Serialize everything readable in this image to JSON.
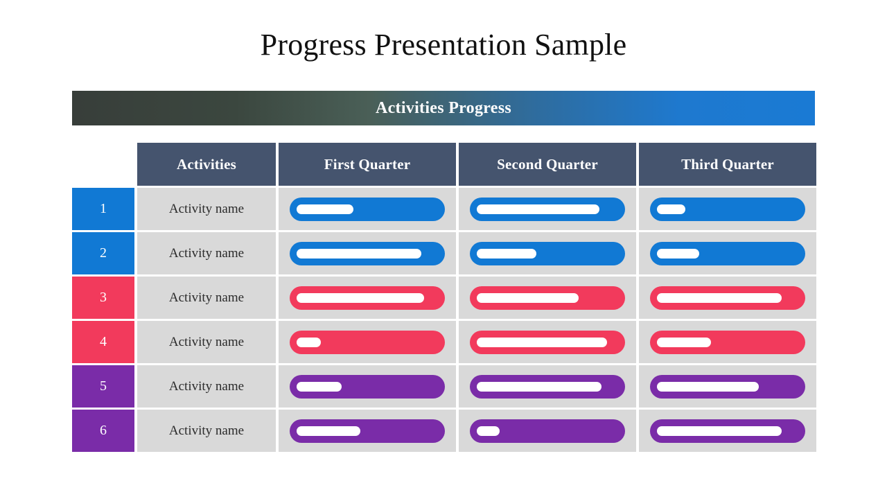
{
  "slide": {
    "title": "Progress Presentation Sample",
    "banner_label": "Activities Progress"
  },
  "colors": {
    "blue": "#1179d4",
    "red": "#f23a5c",
    "purple": "#7a2ca8",
    "header_bg": "#45546e",
    "cell_bg": "#d9d9d9",
    "banner_gradient_start": "#383e3a",
    "banner_gradient_end": "#1a7ad4",
    "bar_inner": "#ffffff"
  },
  "table": {
    "headers": [
      "Activities",
      "First Quarter",
      "Second Quarter",
      "Third Quarter"
    ],
    "rows": [
      {
        "number": "1",
        "activity": "Activity name",
        "color": "#1179d4",
        "quarters": [
          {
            "quarter": "First Quarter",
            "remaining_pct": 40
          },
          {
            "quarter": "Second Quarter",
            "remaining_pct": 87
          },
          {
            "quarter": "Third Quarter",
            "remaining_pct": 20
          }
        ]
      },
      {
        "number": "2",
        "activity": "Activity name",
        "color": "#1179d4",
        "quarters": [
          {
            "quarter": "First Quarter",
            "remaining_pct": 88
          },
          {
            "quarter": "Second Quarter",
            "remaining_pct": 42
          },
          {
            "quarter": "Third Quarter",
            "remaining_pct": 30
          }
        ]
      },
      {
        "number": "3",
        "activity": "Activity name",
        "color": "#f23a5c",
        "quarters": [
          {
            "quarter": "First Quarter",
            "remaining_pct": 90
          },
          {
            "quarter": "Second Quarter",
            "remaining_pct": 72
          },
          {
            "quarter": "Third Quarter",
            "remaining_pct": 88
          }
        ]
      },
      {
        "number": "4",
        "activity": "Activity name",
        "color": "#f23a5c",
        "quarters": [
          {
            "quarter": "First Quarter",
            "remaining_pct": 17
          },
          {
            "quarter": "Second Quarter",
            "remaining_pct": 92
          },
          {
            "quarter": "Third Quarter",
            "remaining_pct": 38
          }
        ]
      },
      {
        "number": "5",
        "activity": "Activity name",
        "color": "#7a2ca8",
        "quarters": [
          {
            "quarter": "First Quarter",
            "remaining_pct": 32
          },
          {
            "quarter": "Second Quarter",
            "remaining_pct": 88
          },
          {
            "quarter": "Third Quarter",
            "remaining_pct": 72
          }
        ]
      },
      {
        "number": "6",
        "activity": "Activity name",
        "color": "#7a2ca8",
        "quarters": [
          {
            "quarter": "First Quarter",
            "remaining_pct": 45
          },
          {
            "quarter": "Second Quarter",
            "remaining_pct": 16
          },
          {
            "quarter": "Third Quarter",
            "remaining_pct": 88
          }
        ]
      }
    ]
  },
  "chart_data": {
    "type": "bar",
    "title": "Activities Progress",
    "categories": [
      "First Quarter",
      "Second Quarter",
      "Third Quarter"
    ],
    "series": [
      {
        "name": "Activity name 1",
        "values": [
          40,
          87,
          20
        ]
      },
      {
        "name": "Activity name 2",
        "values": [
          88,
          42,
          30
        ]
      },
      {
        "name": "Activity name 3",
        "values": [
          90,
          72,
          88
        ]
      },
      {
        "name": "Activity name 4",
        "values": [
          17,
          92,
          38
        ]
      },
      {
        "name": "Activity name 5",
        "values": [
          32,
          88,
          72
        ]
      },
      {
        "name": "Activity name 6",
        "values": [
          45,
          16,
          88
        ]
      }
    ],
    "xlabel": "",
    "ylabel": "",
    "ylim": [
      0,
      100
    ],
    "grid": false,
    "legend": "none"
  }
}
